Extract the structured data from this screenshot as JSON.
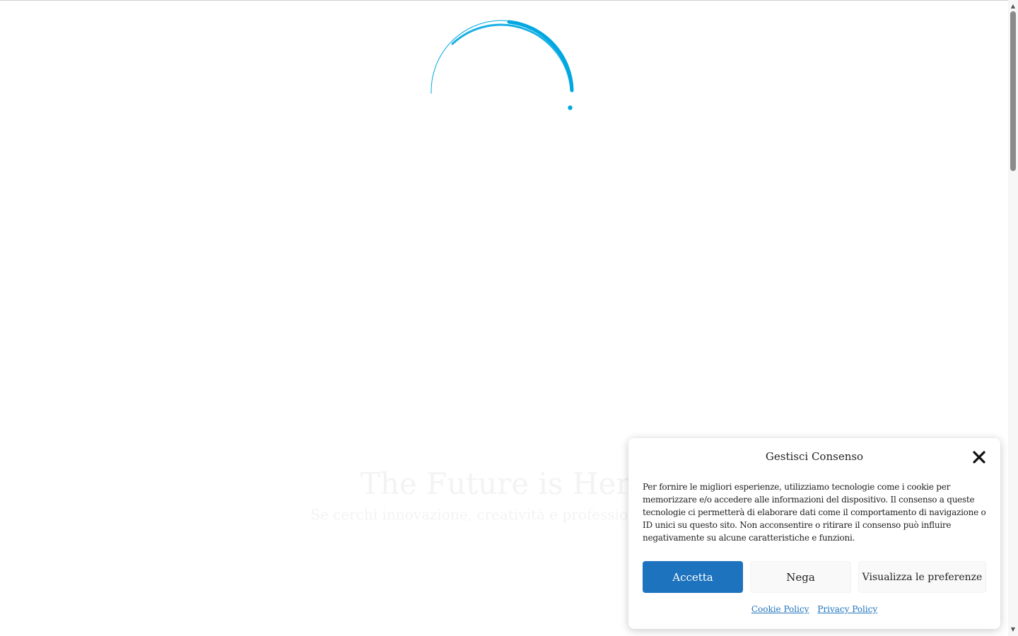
{
  "loader": {
    "color": "#00a7e1",
    "icon": "loading-spinner-icon"
  },
  "hero": {
    "title": "The Future is Here",
    "subtitle": "Se cerchi innovazione, creatività e professionalità, sei"
  },
  "consent": {
    "title": "Gestisci Consenso",
    "close_icon": "close-icon",
    "body": "Per fornire le migliori esperienze, utilizziamo tecnologie come i cookie per memorizzare e/o accedere alle informazioni del dispositivo. Il consenso a queste tecnologie ci permetterà di elaborare dati come il comportamento di navigazione o ID unici su questo sito. Non acconsentire o ritirare il consenso può influire negativamente su alcune caratteristiche e funzioni.",
    "accept_label": "Accetta",
    "deny_label": "Nega",
    "preferences_label": "Visualizza le preferenze",
    "cookie_policy_label": "Cookie Policy",
    "privacy_policy_label": "Privacy Policy",
    "accent_color": "#1e73be"
  }
}
